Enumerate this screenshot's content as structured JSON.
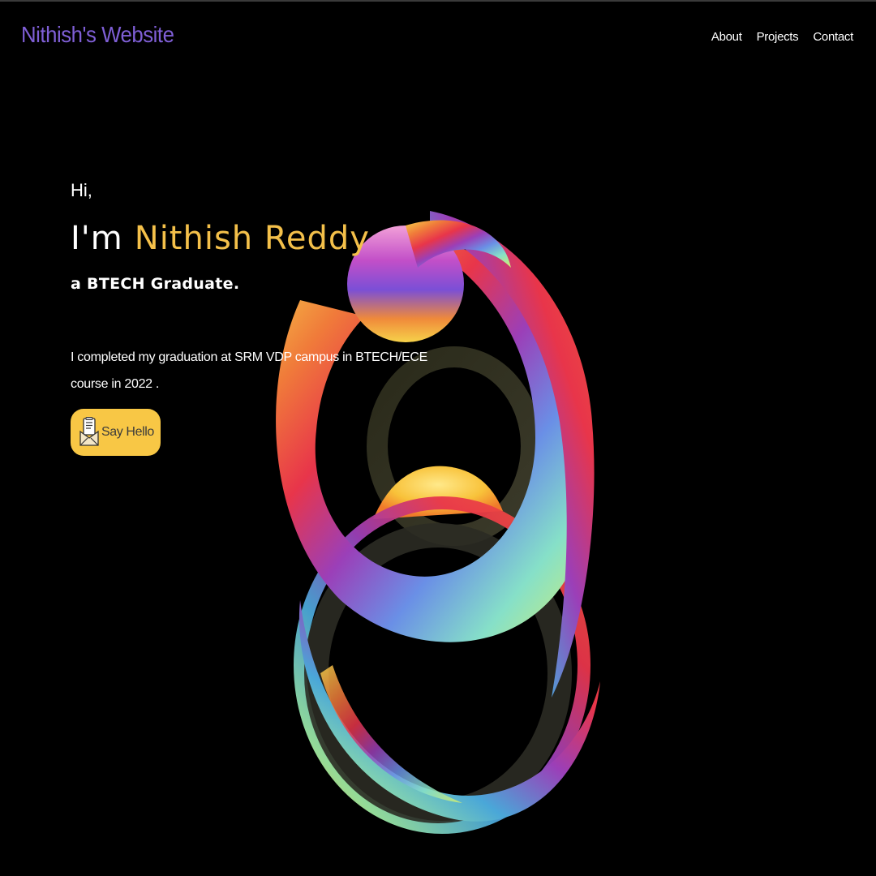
{
  "header": {
    "brand": "Nithish's Website",
    "nav": [
      "About",
      "Projects",
      "Contact"
    ]
  },
  "hero": {
    "greeting": "Hi,",
    "intro": "I'm",
    "name": "Nithish Reddy",
    "role": "a BTECH Graduate.",
    "bio": "I completed my graduation at SRM VDP campus in BTECH/ECE course in 2022 .",
    "button_label": "Say Hello",
    "button_icon": "envelope-letter-icon"
  },
  "colors": {
    "background": "#000000",
    "brand": "#7f5fd6",
    "accent": "#f4c04a",
    "button_bg": "#f8c745",
    "button_text": "#3b3b3b",
    "text": "#ffffff"
  }
}
